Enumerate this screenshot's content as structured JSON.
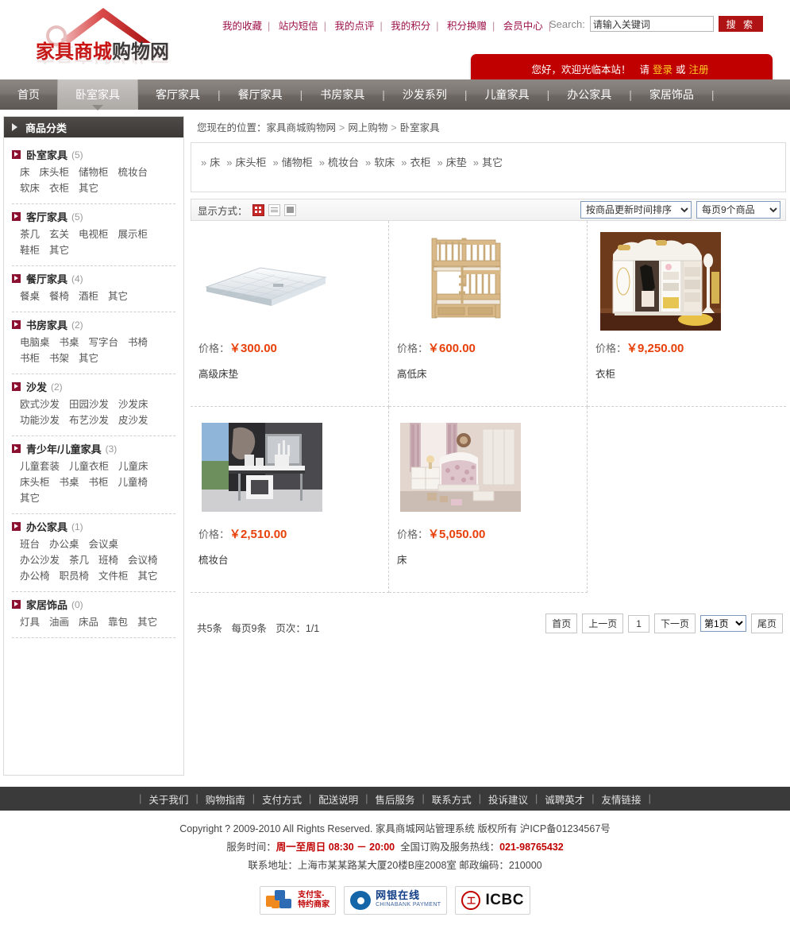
{
  "site": {
    "logo_red": "家具商城",
    "logo_dark": "购物网",
    "logo_full": "家具商城购物网"
  },
  "header": {
    "top_links": [
      "我的收藏",
      "站内短信",
      "我的点评",
      "我的积分",
      "积分换赠",
      "会员中心"
    ],
    "search_label": "Search:",
    "search_placeholder": "请输入关键词",
    "search_value": "请输入关键词",
    "search_button": "搜 索",
    "welcome_text": "您好，欢迎光临本站！",
    "welcome_please": "请",
    "welcome_login": "登录",
    "welcome_or": "或",
    "welcome_register": "注册"
  },
  "mainnav": {
    "items": [
      {
        "label": "首页",
        "active": false
      },
      {
        "label": "卧室家具",
        "active": true
      },
      {
        "label": "客厅家具",
        "active": false
      },
      {
        "label": "餐厅家具",
        "active": false
      },
      {
        "label": "书房家具",
        "active": false
      },
      {
        "label": "沙发系列",
        "active": false
      },
      {
        "label": "儿童家具",
        "active": false
      },
      {
        "label": "办公家具",
        "active": false
      },
      {
        "label": "家居饰品",
        "active": false
      }
    ],
    "separator": "|"
  },
  "sidebar": {
    "title": "商品分类",
    "categories": [
      {
        "name": "卧室家具",
        "count": "(5)",
        "subs": [
          "床",
          "床头柜",
          "储物柜",
          "梳妆台",
          "软床",
          "衣柜",
          "其它"
        ]
      },
      {
        "name": "客厅家具",
        "count": "(5)",
        "subs": [
          "茶几",
          "玄关",
          "电视柜",
          "展示柜",
          "鞋柜",
          "其它"
        ]
      },
      {
        "name": "餐厅家具",
        "count": "(4)",
        "subs": [
          "餐桌",
          "餐椅",
          "酒柜",
          "其它"
        ]
      },
      {
        "name": "书房家具",
        "count": "(2)",
        "subs": [
          "电脑桌",
          "书桌",
          "写字台",
          "书椅",
          "书柜",
          "书架",
          "其它"
        ]
      },
      {
        "name": "沙发",
        "count": "(2)",
        "subs": [
          "欧式沙发",
          "田园沙发",
          "沙发床",
          "功能沙发",
          "布艺沙发",
          "皮沙发"
        ]
      },
      {
        "name": "青少年/儿童家具",
        "count": "(3)",
        "subs": [
          "儿童套装",
          "儿童衣柜",
          "儿童床",
          "床头柜",
          "书桌",
          "书柜",
          "儿童椅",
          "其它"
        ]
      },
      {
        "name": "办公家具",
        "count": "(1)",
        "subs": [
          "班台",
          "办公桌",
          "会议桌",
          "办公沙发",
          "茶几",
          "班椅",
          "会议椅",
          "办公椅",
          "职员椅",
          "文件柜",
          "其它"
        ]
      },
      {
        "name": "家居饰品",
        "count": "(0)",
        "subs": [
          "灯具",
          "油画",
          "床品",
          "靠包",
          "其它"
        ]
      }
    ]
  },
  "breadcrumb": {
    "prefix": "您现在的位置：",
    "items": [
      "家具商城购物网",
      "网上购物",
      "卧室家具"
    ],
    "separator": ">"
  },
  "subnav": {
    "marker": "»",
    "items": [
      "床",
      "床头柜",
      "储物柜",
      "梳妆台",
      "软床",
      "衣柜",
      "床垫",
      "其它"
    ]
  },
  "toolbar": {
    "display_label": "显示方式：",
    "modes": [
      "grid-view-icon",
      "list-view-icon",
      "detail-view-icon"
    ],
    "sort_selected": "按商品更新时间排序",
    "sort_options": [
      "按商品更新时间排序"
    ],
    "perpage_selected": "每页9个商品",
    "perpage_options": [
      "每页9个商品"
    ]
  },
  "products": [
    {
      "price_label": "价格：",
      "currency": "￥",
      "price": "300.00",
      "name": "高级床垫",
      "image": "mattress"
    },
    {
      "price_label": "价格：",
      "currency": "￥",
      "price": "600.00",
      "name": "高低床",
      "image": "bunk-bed"
    },
    {
      "price_label": "价格：",
      "currency": "￥",
      "price": "9,250.00",
      "name": "衣柜",
      "image": "wardrobe"
    },
    {
      "price_label": "价格：",
      "currency": "￥",
      "price": "2,510.00",
      "name": "梳妆台",
      "image": "dresser"
    },
    {
      "price_label": "价格：",
      "currency": "￥",
      "price": "5,050.00",
      "name": "床",
      "image": "bed"
    }
  ],
  "pager": {
    "total": "共5条",
    "per_page": "每页9条",
    "page_index": "页次：1/1",
    "first": "首页",
    "prev": "上一页",
    "current": "1",
    "next": "下一页",
    "jump_selected": "第1页",
    "jump_options": [
      "第1页"
    ],
    "last": "尾页"
  },
  "footer": {
    "links": [
      "关于我们",
      "购物指南",
      "支付方式",
      "配送说明",
      "售后服务",
      "联系方式",
      "投诉建议",
      "诚聘英才",
      "友情链接"
    ],
    "copyright": "Copyright ? 2009-2010 All Rights Reserved. 家具商城网站管理系统 版权所有   沪ICP备01234567号",
    "service_label": "服务时间：",
    "service_days": "周一至周日",
    "service_hours": "08:30 － 20:00",
    "hotline_label": "全国订购及服务热线：",
    "hotline": "021-98765432",
    "address": "联系地址：上海市某某路某大厦20楼B座2008室   邮政编码：210000",
    "pay_alipay_line1": "支付宝-",
    "pay_alipay_line2": "特约商家",
    "pay_chinabank_cn": "网银在线",
    "pay_chinabank_en": "CHINABANK   PAYMENT",
    "pay_icbc_mark": "工",
    "pay_icbc_text": "ICBC"
  }
}
